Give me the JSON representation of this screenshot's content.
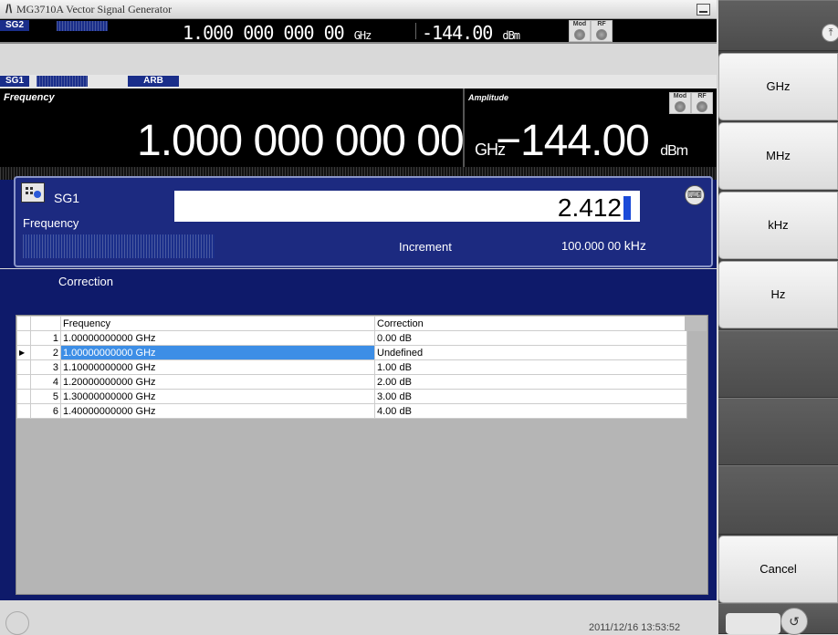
{
  "window": {
    "title": "MG3710A  Vector Signal Generator"
  },
  "sg2": {
    "label": "SG2",
    "frequency": "1.000 000 000 00",
    "frequency_unit": "GHz",
    "amplitude": "-144.00",
    "amplitude_unit": "dBm",
    "mod_label": "Mod",
    "rf_label": "RF"
  },
  "sg1": {
    "label": "SG1",
    "mode": "ARB"
  },
  "display": {
    "frequency_label": "Frequency",
    "frequency": "1.000 000 000 00",
    "frequency_unit": "GHz",
    "amplitude_label": "Amplitude",
    "amplitude": "−144.00",
    "amplitude_unit": "dBm",
    "mod_label": "Mod",
    "rf_label": "RF"
  },
  "input": {
    "channel": "SG1",
    "parameter": "Frequency",
    "value": "2.412",
    "increment_label": "Increment",
    "increment_value": "100.000 00",
    "increment_unit": "kHz"
  },
  "correction": {
    "title": "Correction",
    "columns": [
      "Frequency",
      "Correction"
    ],
    "rows": [
      {
        "num": "1",
        "frequency": "1.00000000000 GHz",
        "correction": "0.00 dB"
      },
      {
        "num": "2",
        "frequency": "1.00000000000 GHz",
        "correction": "Undefined",
        "selected": true
      },
      {
        "num": "3",
        "frequency": "1.10000000000 GHz",
        "correction": "1.00 dB"
      },
      {
        "num": "4",
        "frequency": "1.20000000000 GHz",
        "correction": "2.00 dB"
      },
      {
        "num": "5",
        "frequency": "1.30000000000 GHz",
        "correction": "3.00 dB"
      },
      {
        "num": "6",
        "frequency": "1.40000000000 GHz",
        "correction": "4.00 dB"
      }
    ]
  },
  "status": {
    "datetime": "2011/12/16 13:53:52"
  },
  "softkeys": [
    "GHz",
    "MHz",
    "kHz",
    "Hz",
    "Cancel"
  ],
  "icons": {
    "top": "scroll-up-icon",
    "bottom": "return-icon",
    "keyboard": "keyboard-icon"
  }
}
